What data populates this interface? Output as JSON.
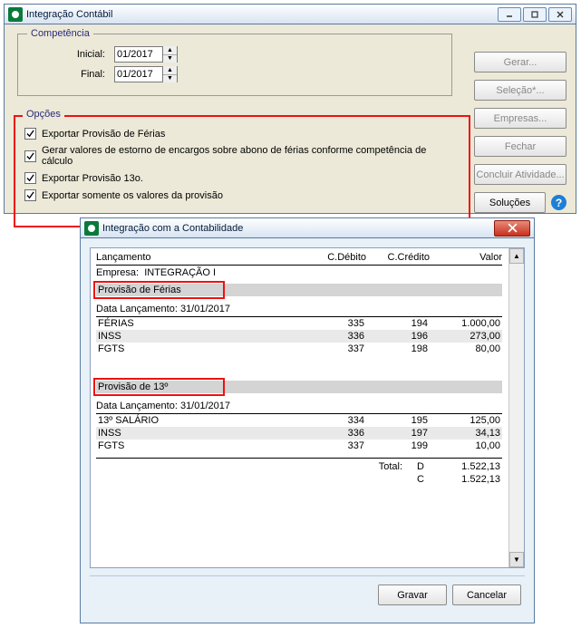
{
  "win1": {
    "title": "Integração Contábil",
    "competencia": {
      "legend": "Competência",
      "inicial_label": "Inicial:",
      "final_label": "Final:",
      "inicial_value": "01/2017",
      "final_value": "01/2017"
    },
    "opcoes": {
      "legend": "Opções",
      "items": [
        "Exportar Provisão de Férias",
        "Gerar valores de estorno de encargos sobre abono de férias conforme competência de cálculo",
        "Exportar Provisão 13o.",
        "Exportar somente os valores da provisão"
      ]
    },
    "buttons": {
      "gerar": "Gerar...",
      "selecao": "Seleção*...",
      "empresas": "Empresas...",
      "fechar": "Fechar",
      "concluir": "Concluir Atividade...",
      "solucoes": "Soluções"
    }
  },
  "win2": {
    "title": "Integração com a Contabilidade",
    "headers": {
      "col1": "Lançamento",
      "col2": "C.Débito",
      "col3": "C.Crédito",
      "col4": "Valor"
    },
    "empresa_label": "Empresa:",
    "empresa_value": "INTEGRAÇÃO I",
    "sec1": {
      "title": "Provisão de Férias",
      "sub": "Data Lançamento: 31/01/2017",
      "rows": [
        {
          "n": "FÉRIAS",
          "d": "335",
          "c": "194",
          "v": "1.000,00"
        },
        {
          "n": "INSS",
          "d": "336",
          "c": "196",
          "v": "273,00"
        },
        {
          "n": "FGTS",
          "d": "337",
          "c": "198",
          "v": "80,00"
        }
      ]
    },
    "sec2": {
      "title": "Provisão de 13º",
      "sub": "Data Lançamento: 31/01/2017",
      "rows": [
        {
          "n": "13º SALÁRIO",
          "d": "334",
          "c": "195",
          "v": "125,00"
        },
        {
          "n": "INSS",
          "d": "336",
          "c": "197",
          "v": "34,13"
        },
        {
          "n": "FGTS",
          "d": "337",
          "c": "199",
          "v": "10,00"
        }
      ]
    },
    "totals": {
      "label": "Total:",
      "d_label": "D",
      "c_label": "C",
      "d_value": "1.522,13",
      "c_value": "1.522,13"
    },
    "buttons": {
      "gravar": "Gravar",
      "cancelar": "Cancelar"
    }
  }
}
